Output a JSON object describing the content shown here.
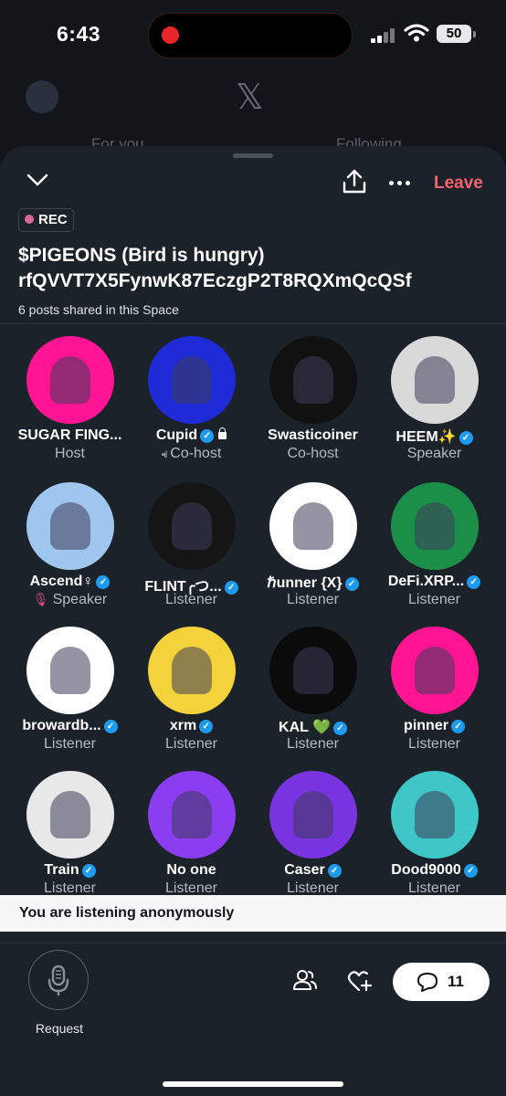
{
  "status_bar": {
    "time": "6:43",
    "battery": "50"
  },
  "background_app": {
    "tabs": [
      "For you",
      "Following"
    ]
  },
  "space": {
    "leave_label": "Leave",
    "rec_label": "REC",
    "title_line1": "$PIGEONS (Bird is hungry)",
    "title_line2": "rfQVVT7X5FynwK87EczgP2T8RQXmQcQSf",
    "posts_shared": "6 posts shared in this Space"
  },
  "participants": [
    {
      "name": "SUGAR FING...",
      "role": "Host",
      "verified": false,
      "color": "#ff1493"
    },
    {
      "name": "Cupid",
      "role": "Co-host",
      "verified": true,
      "color": "#1e2bd6"
    },
    {
      "name": "Swasticoiner",
      "role": "Co-host",
      "verified": false,
      "color": "#111111"
    },
    {
      "name": "HEEM✨",
      "role": "Speaker",
      "verified": true,
      "color": "#d9d9d9"
    },
    {
      "name": "Ascend♀",
      "role": "Speaker",
      "verified": true,
      "color": "#9fc6ee"
    },
    {
      "name": "FLINT╭つ...",
      "role": "Listener",
      "verified": true,
      "color": "#151515"
    },
    {
      "name": "ℏunner {X}",
      "role": "Listener",
      "verified": true,
      "color": "#ffffff"
    },
    {
      "name": "DeFi.XRP...",
      "role": "Listener",
      "verified": true,
      "color": "#1b8f47"
    },
    {
      "name": "browardb...",
      "role": "Listener",
      "verified": true,
      "color": "#ffffff"
    },
    {
      "name": "xrm",
      "role": "Listener",
      "verified": true,
      "color": "#f4d23c"
    },
    {
      "name": "KAL 💚",
      "role": "Listener",
      "verified": true,
      "color": "#0b0b0b"
    },
    {
      "name": "pinner",
      "role": "Listener",
      "verified": true,
      "color": "#ff1493"
    },
    {
      "name": "Train",
      "role": "Listener",
      "verified": true,
      "color": "#e8e8e8"
    },
    {
      "name": "No one",
      "role": "Listener",
      "verified": false,
      "color": "#8b3df0"
    },
    {
      "name": "Caser",
      "role": "Listener",
      "verified": true,
      "color": "#7a33e0"
    },
    {
      "name": "Dood9000",
      "role": "Listener",
      "verified": true,
      "color": "#3fc7c7"
    }
  ],
  "anonymous_notice": "You are listening anonymously",
  "footer": {
    "request_label": "Request",
    "comment_count": "11"
  },
  "colors": {
    "leave": "#f4646e",
    "verified": "#1d9bf0",
    "sheet": "#1c2229"
  }
}
